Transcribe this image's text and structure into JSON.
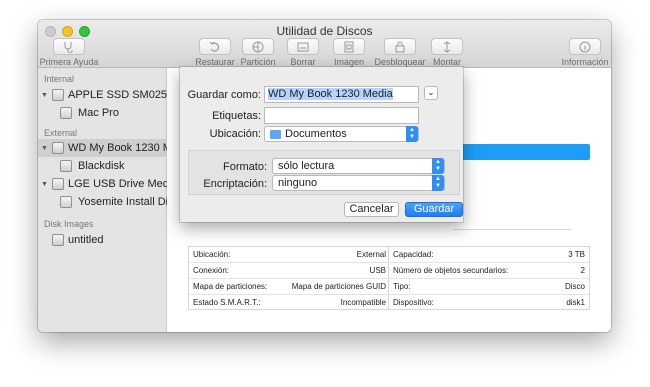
{
  "window": {
    "title": "Utilidad de Discos"
  },
  "toolbar": {
    "buttons": [
      {
        "label": "Primera Ayuda"
      },
      {
        "label": "Restaurar"
      },
      {
        "label": "Partición"
      },
      {
        "label": "Borrar"
      },
      {
        "label": "Imagen"
      },
      {
        "label": "Desbloquear"
      },
      {
        "label": "Montar"
      },
      {
        "label": "Información"
      }
    ]
  },
  "sidebar": {
    "sections": {
      "internal": "Internal",
      "external": "External",
      "disk_images": "Disk Images"
    },
    "items": [
      {
        "label": "APPLE SSD SM0256..."
      },
      {
        "label": "Mac Pro"
      },
      {
        "label": "WD My Book 1230 M..."
      },
      {
        "label": "Blackdisk"
      },
      {
        "label": "LGE USB Drive Media"
      },
      {
        "label": "Yosemite Install Di..."
      },
      {
        "label": "untitled"
      }
    ]
  },
  "dialog": {
    "save_as_label": "Guardar como:",
    "save_as_value": "WD My Book 1230 Media",
    "tags_label": "Etiquetas:",
    "tags_value": "",
    "location_label": "Ubicación:",
    "location_value": "Documentos",
    "format_label": "Formato:",
    "format_value": "sólo lectura",
    "encryption_label": "Encriptación:",
    "encryption_value": "ninguno",
    "cancel_label": "Cancelar",
    "save_label": "Guardar"
  },
  "info": {
    "left": [
      {
        "key": "Ubicación:",
        "value": "External"
      },
      {
        "key": "Conexión:",
        "value": "USB"
      },
      {
        "key": "Mapa de particiones:",
        "value": "Mapa de particiones GUID"
      },
      {
        "key": "Estado S.M.A.R.T.:",
        "value": "Incompatible"
      }
    ],
    "right": [
      {
        "key": "Capacidad:",
        "value": "3 TB"
      },
      {
        "key": "Número de objetos secundarios:",
        "value": "2"
      },
      {
        "key": "Tipo:",
        "value": "Disco"
      },
      {
        "key": "Dispositivo:",
        "value": "disk1"
      }
    ]
  },
  "colors": {
    "accent": "#1e9df6",
    "selection": "#b3d4fc"
  }
}
